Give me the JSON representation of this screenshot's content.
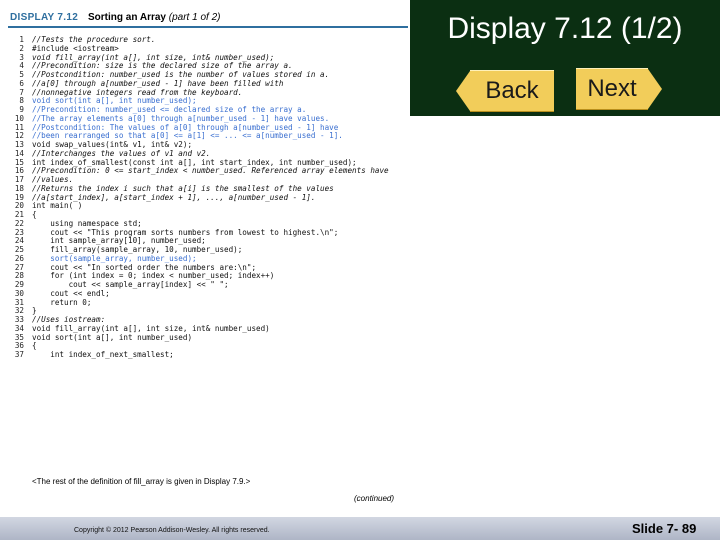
{
  "display": {
    "label": "DISPLAY 7.12",
    "title": "Sorting an Array",
    "part": "(part 1 of 2)"
  },
  "slide": {
    "title": "Display 7.12 (1/2)",
    "back_label": "Back",
    "next_label": "Next",
    "number": "Slide 7- 89"
  },
  "code_lines": [
    {
      "n": "1",
      "t": "//Tests the procedure sort.",
      "c": "comment"
    },
    {
      "n": "2",
      "t": "#include <iostream>",
      "c": ""
    },
    {
      "n": "3",
      "t": "void fill_array(int a[], int size, int& number_used);",
      "c": "comment"
    },
    {
      "n": "4",
      "t": "//Precondition: size is the declared size of the array a.",
      "c": "comment"
    },
    {
      "n": "5",
      "t": "//Postcondition: number_used is the number of values stored in a.",
      "c": "comment"
    },
    {
      "n": "6",
      "t": "//a[0] through a[number_used - 1] have been filled with",
      "c": "comment"
    },
    {
      "n": "7",
      "t": "//nonnegative integers read from the keyboard.",
      "c": "comment"
    },
    {
      "n": "8",
      "t": "void sort(int a[], int number_used);",
      "c": "hl"
    },
    {
      "n": "9",
      "t": "//Precondition: number_used <= declared size of the array a.",
      "c": "hl"
    },
    {
      "n": "10",
      "t": "//The array elements a[0] through a[number_used - 1] have values.",
      "c": "hl"
    },
    {
      "n": "11",
      "t": "//Postcondition: The values of a[0] through a[number_used - 1] have",
      "c": "hl"
    },
    {
      "n": "12",
      "t": "//been rearranged so that a[0] <= a[1] <= ... <= a[number_used - 1].",
      "c": "hl"
    },
    {
      "n": "13",
      "t": "void swap_values(int& v1, int& v2);",
      "c": ""
    },
    {
      "n": "14",
      "t": "//Interchanges the values of v1 and v2.",
      "c": "comment"
    },
    {
      "n": "15",
      "t": "int index_of_smallest(const int a[], int start_index, int number_used);",
      "c": ""
    },
    {
      "n": "16",
      "t": "//Precondition: 0 <= start_index < number_used. Referenced array elements have",
      "c": "comment"
    },
    {
      "n": "17",
      "t": "//values.",
      "c": "comment"
    },
    {
      "n": "18",
      "t": "//Returns the index i such that a[i] is the smallest of the values",
      "c": "comment"
    },
    {
      "n": "19",
      "t": "//a[start_index], a[start_index + 1], ..., a[number_used - 1].",
      "c": "comment"
    },
    {
      "n": "20",
      "t": "int main( )",
      "c": ""
    },
    {
      "n": "21",
      "t": "{",
      "c": ""
    },
    {
      "n": "22",
      "t": "    using namespace std;",
      "c": ""
    },
    {
      "n": "23",
      "t": "    cout << \"This program sorts numbers from lowest to highest.\\n\";",
      "c": ""
    },
    {
      "n": "24",
      "t": "    int sample_array[10], number_used;",
      "c": ""
    },
    {
      "n": "25",
      "t": "    fill_array(sample_array, 10, number_used);",
      "c": ""
    },
    {
      "n": "26",
      "t": "    sort(sample_array, number_used);",
      "c": "hl"
    },
    {
      "n": "27",
      "t": "    cout << \"In sorted order the numbers are:\\n\";",
      "c": ""
    },
    {
      "n": "28",
      "t": "    for (int index = 0; index < number_used; index++)",
      "c": ""
    },
    {
      "n": "29",
      "t": "        cout << sample_array[index] << \" \";",
      "c": ""
    },
    {
      "n": "30",
      "t": "    cout << endl;",
      "c": ""
    },
    {
      "n": "31",
      "t": "    return 0;",
      "c": ""
    },
    {
      "n": "32",
      "t": "}",
      "c": ""
    },
    {
      "n": "33",
      "t": "//Uses iostream:",
      "c": "comment"
    },
    {
      "n": "34",
      "t": "void fill_array(int a[], int size, int& number_used)",
      "c": ""
    },
    {
      "n": "35",
      "t": "void sort(int a[], int number_used)",
      "c": ""
    },
    {
      "n": "36",
      "t": "{",
      "c": ""
    },
    {
      "n": "37",
      "t": "    int index_of_next_smallest;",
      "c": ""
    }
  ],
  "prose_note": "<The rest of the definition of fill_array is given in Display 7.9.>",
  "continued": "(continued)",
  "footer": {
    "copyright": "Copyright © 2012 Pearson Addison-Wesley. All rights reserved."
  }
}
